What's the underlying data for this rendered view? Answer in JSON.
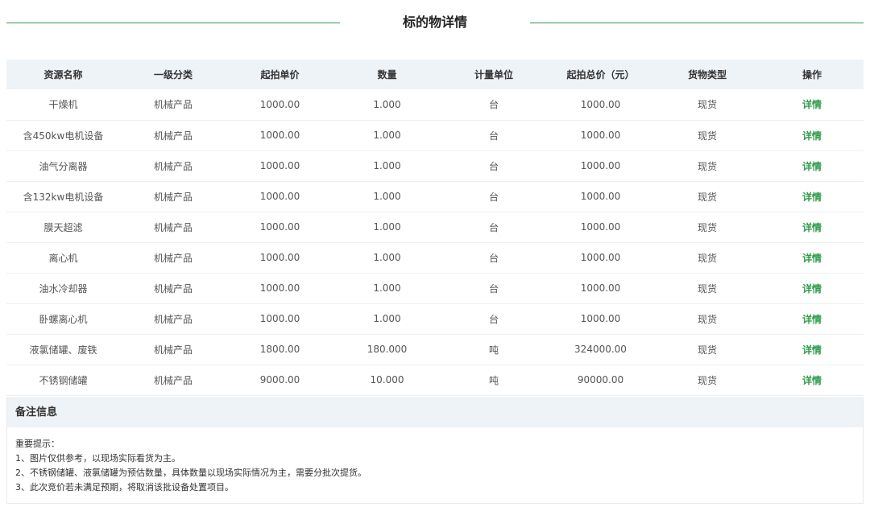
{
  "page": {
    "title": "标的物详情"
  },
  "table": {
    "headers": [
      "资源名称",
      "一级分类",
      "起拍单价",
      "数量",
      "计量单位",
      "起拍总价（元）",
      "货物类型",
      "操作"
    ],
    "rows": [
      [
        "干燥机",
        "机械产品",
        "1000.00",
        "1.000",
        "台",
        "1000.00",
        "现货",
        "详情"
      ],
      [
        "含450kw电机设备",
        "机械产品",
        "1000.00",
        "1.000",
        "台",
        "1000.00",
        "现货",
        "详情"
      ],
      [
        "油气分离器",
        "机械产品",
        "1000.00",
        "1.000",
        "台",
        "1000.00",
        "现货",
        "详情"
      ],
      [
        "含132kw电机设备",
        "机械产品",
        "1000.00",
        "1.000",
        "台",
        "1000.00",
        "现货",
        "详情"
      ],
      [
        "膜天超滤",
        "机械产品",
        "1000.00",
        "1.000",
        "台",
        "1000.00",
        "现货",
        "详情"
      ],
      [
        "离心机",
        "机械产品",
        "1000.00",
        "1.000",
        "台",
        "1000.00",
        "现货",
        "详情"
      ],
      [
        "油水冷却器",
        "机械产品",
        "1000.00",
        "1.000",
        "台",
        "1000.00",
        "现货",
        "详情"
      ],
      [
        "卧螺离心机",
        "机械产品",
        "1000.00",
        "1.000",
        "台",
        "1000.00",
        "现货",
        "详情"
      ],
      [
        "液氯储罐、废铁",
        "机械产品",
        "1800.00",
        "180.000",
        "吨",
        "324000.00",
        "现货",
        "详情"
      ],
      [
        "不锈钢储罐",
        "机械产品",
        "9000.00",
        "10.000",
        "吨",
        "90000.00",
        "现货",
        "详情"
      ]
    ]
  },
  "remarks": {
    "title": "备注信息",
    "lines": [
      "重要提示：",
      "1、图片仅供参考，以现场实际看货为主。",
      "2、不锈钢储罐、液氯储罐为预估数量，具体数量以现场实际情况为主，需要分批次提货。",
      "3、此次竞价若未满足预期，将取消该批设备处置项目。"
    ]
  },
  "colors": {
    "accent": "#2e9b4a",
    "header_bg": "#eef3f8",
    "row_border": "#edf0f2"
  }
}
